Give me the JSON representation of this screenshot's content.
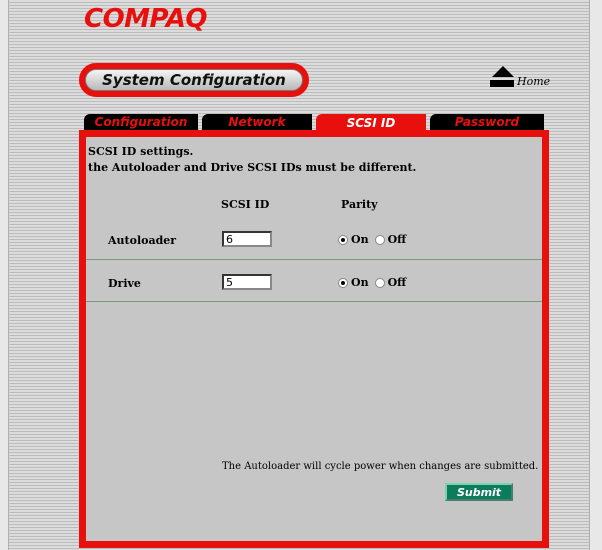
{
  "logo": "COMPAQ",
  "header": {
    "title": "System Configuration",
    "home_label": "Home"
  },
  "tabs": [
    {
      "label": "Configuration",
      "active": false
    },
    {
      "label": "Network",
      "active": false
    },
    {
      "label": "SCSI ID",
      "active": true
    },
    {
      "label": "Password",
      "active": false
    }
  ],
  "main": {
    "title": "SCSI ID settings.",
    "subtitle": "the Autoloader and Drive SCSI IDs must be different.",
    "columns": {
      "scsi_id": "SCSI ID",
      "parity": "Parity"
    },
    "rows": [
      {
        "label": "Autoloader",
        "scsi_id": "6",
        "parity": "On"
      },
      {
        "label": "Drive",
        "scsi_id": "5",
        "parity": "On"
      }
    ],
    "radio_on": "On",
    "radio_off": "Off",
    "note": "The Autoloader will cycle power when changes are submitted.",
    "submit_label": "Submit"
  },
  "colors": {
    "brand_red": "#e8100c",
    "submit_green": "#0c7d5c",
    "panel_gray": "#c6c6c6"
  }
}
